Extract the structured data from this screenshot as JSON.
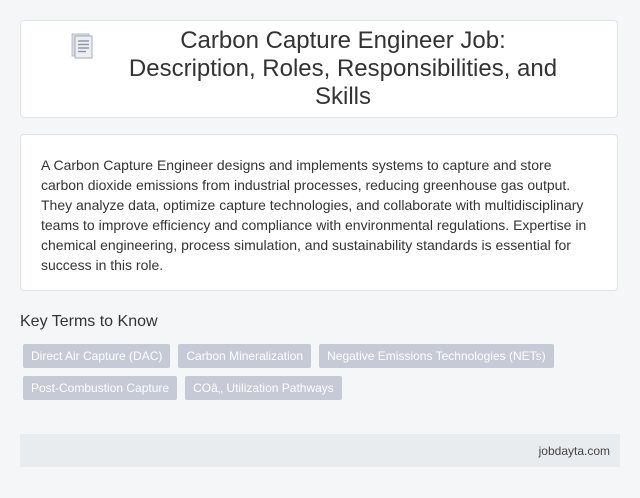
{
  "header": {
    "icon": "document-icon",
    "title": "Carbon Capture Engineer Job: Description, Roles, Responsibilities, and Skills"
  },
  "description": {
    "text": "A Carbon Capture Engineer designs and implements systems to capture and store carbon dioxide emissions from industrial processes, reducing greenhouse gas output. They analyze data, optimize capture technologies, and collaborate with multidisciplinary teams to improve efficiency and compliance with environmental regulations. Expertise in chemical engineering, process simulation, and sustainability standards is essential for success in this role."
  },
  "key_terms": {
    "heading": "Key Terms to Know",
    "tags": [
      "Direct Air Capture (DAC)",
      "Carbon Mineralization",
      "Negative Emissions Technologies (NETs)",
      "Post-Combustion Capture",
      "COâ‚‚ Utilization Pathways"
    ]
  },
  "footer": {
    "site": "jobdayta.com"
  },
  "colors": {
    "background": "#f5f6f8",
    "card": "#ffffff",
    "tag_bg": "#c5cad6",
    "footer_bg": "#e9ecef"
  }
}
